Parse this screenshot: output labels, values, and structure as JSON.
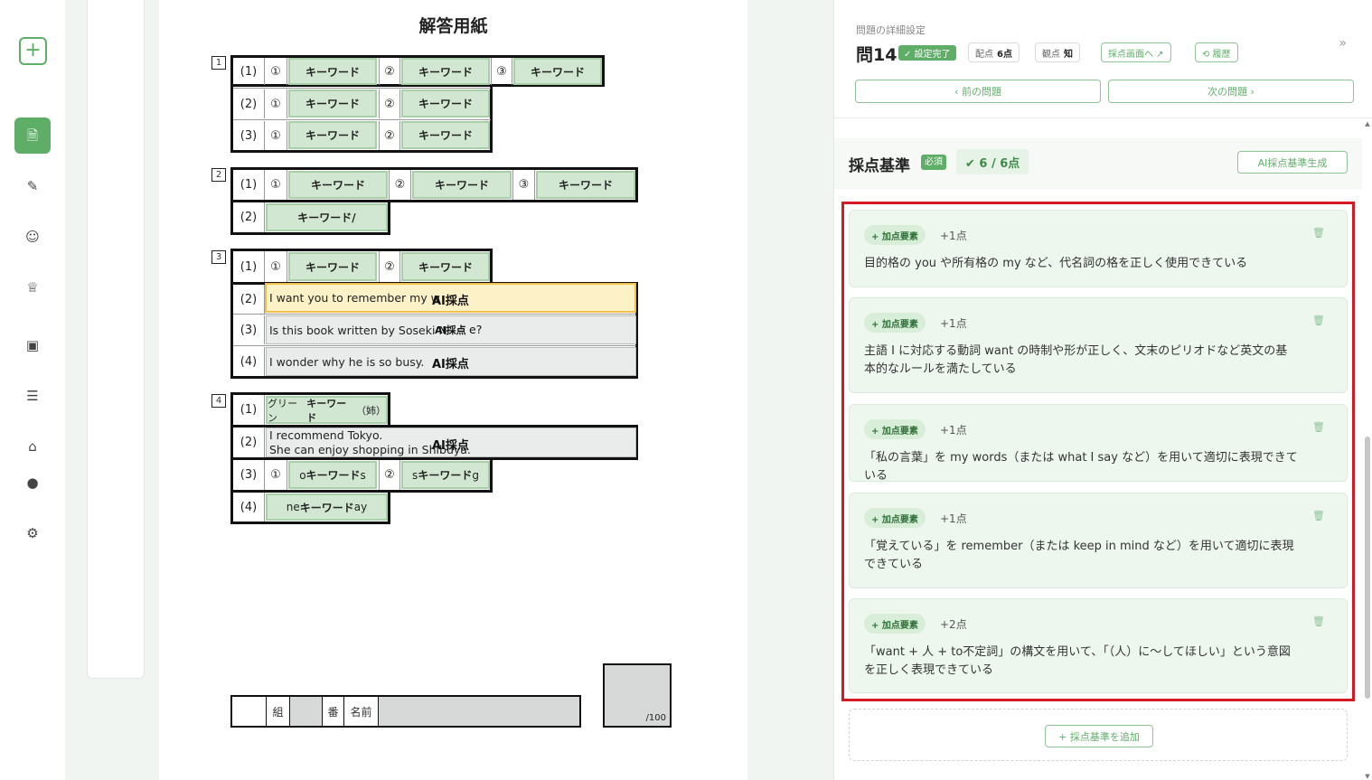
{
  "rail": {
    "new_icon": "+",
    "items": [
      {
        "icon": "document-icon",
        "glyph": "🗎"
      },
      {
        "icon": "pen-icon",
        "glyph": "✎"
      },
      {
        "icon": "group-icon",
        "glyph": "☺"
      },
      {
        "icon": "graduation-icon",
        "glyph": "♕"
      },
      {
        "icon": "gallery-icon",
        "glyph": "▣"
      },
      {
        "icon": "list-icon",
        "glyph": "☰"
      },
      {
        "icon": "classroom-icon",
        "glyph": "⌂"
      },
      {
        "icon": "user-icon",
        "glyph": "●"
      },
      {
        "icon": "settings-icon",
        "glyph": "⚙"
      }
    ]
  },
  "sheet": {
    "title": "解答用紙",
    "keyword": "キーワード",
    "ai_label": "AI採点",
    "q1": {
      "num": "1",
      "rows": [
        "(1)",
        "(2)",
        "(3)"
      ]
    },
    "q2": {
      "num": "2",
      "rows": [
        "(1)",
        "(2)"
      ],
      "r2_text": "キーワード/"
    },
    "q3": {
      "num": "3",
      "rows": [
        "(1)",
        "(2)",
        "(3)",
        "(4)"
      ],
      "t2": "I want you to remember my w",
      "t3": "Is this book written by Soseki N",
      "t3_tail": "e?",
      "t4": "I wonder why he is so busy."
    },
    "q4": {
      "num": "4",
      "rows": [
        "(1)",
        "(2)",
        "(3)",
        "(4)"
      ],
      "r1_pre": "グリーン",
      "r1_post": "（姉）",
      "t2a": "I recommend Tokyo.",
      "t2b": "She can enjoy shopping in Shibuya.",
      "r3a_pre": "o",
      "r3a_post": "s",
      "r3b_pre": "s",
      "r3b_post": "g",
      "r4_pre": "ne",
      "r4_post": "ay"
    },
    "marks": [
      "①",
      "②",
      "③"
    ],
    "footer": {
      "kumi": "組",
      "ban": "番",
      "name": "名前"
    },
    "score": "/100"
  },
  "panel": {
    "subtitle": "問題の詳細設定",
    "title": "問14",
    "done_badge": "✓ 設定完了",
    "haiten_label": "配点",
    "haiten_value": "6点",
    "kanten_label": "観点",
    "kanten_value": "知",
    "grading_view": "採点画面へ ↗",
    "history": "⟲ 履歴",
    "collapse": "»",
    "prev": "‹  前の問題",
    "next": "次の問題  ›",
    "criteria_title": "採点基準",
    "required": "必須",
    "points_badge": "✔ 6 / 6点",
    "ai_generate": "AI採点基準生成",
    "add_button": "+ 採点基準を追加",
    "criteria": [
      {
        "kind": "+ 加点要素",
        "point": "+1点",
        "desc": "目的格の you や所有格の my など、代名詞の格を正しく使用できている"
      },
      {
        "kind": "+ 加点要素",
        "point": "+1点",
        "desc": "主語 I に対応する動詞 want の時制や形が正しく、文末のピリオドなど英文の基本的なルールを満たしている"
      },
      {
        "kind": "+ 加点要素",
        "point": "+1点",
        "desc": "「私の言葉」を my words（または what I say など）を用いて適切に表現できている"
      },
      {
        "kind": "+ 加点要素",
        "point": "+1点",
        "desc": "「覚えている」を remember（または keep in mind など）を用いて適切に表現できている"
      },
      {
        "kind": "+ 加点要素",
        "point": "+2点",
        "desc": "「want + 人 + to不定詞」の構文を用いて、「（人）に〜してほしい」という意図を正しく表現できている"
      }
    ]
  },
  "colors": {
    "accent": "#5fae68",
    "highlight": "#d51a24",
    "selected": "#f0c04a"
  }
}
